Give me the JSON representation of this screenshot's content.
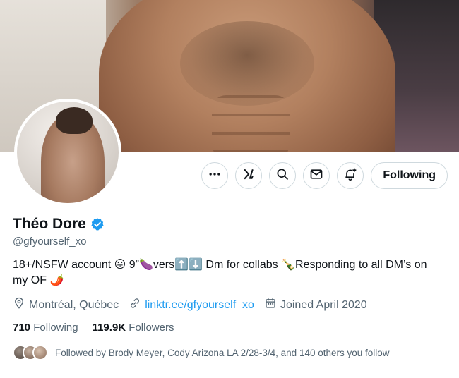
{
  "profile": {
    "display_name": "Théo Dore",
    "handle": "@gfyourself_xo",
    "bio": "18+/NSFW account 😛 9”🍆vers⬆️⬇️ Dm for collabs 🍾Responding to all DM’s on my OF 🌶️",
    "location": "Montréal, Québec",
    "website": "linktr.ee/gfyourself_xo",
    "joined": "Joined April 2020"
  },
  "stats": {
    "following_count": "710",
    "following_label": "Following",
    "followers_count": "119.9K",
    "followers_label": "Followers"
  },
  "actions": {
    "follow_label": "Following"
  },
  "followed_by": {
    "text": "Followed by Brody Meyer, Cody Arizona LA 2/28-3/4, and 140 others you follow"
  },
  "icons": {
    "more": "more-icon",
    "grok": "grok-icon",
    "search": "search-icon",
    "message": "message-icon",
    "notify": "notification-bell-icon",
    "verified": "verified-badge-icon",
    "location": "location-pin-icon",
    "link": "link-icon",
    "calendar": "calendar-icon"
  },
  "colors": {
    "accent": "#1d9bf0",
    "text": "#0f1419",
    "secondary": "#536471",
    "border": "#cfd9de"
  }
}
